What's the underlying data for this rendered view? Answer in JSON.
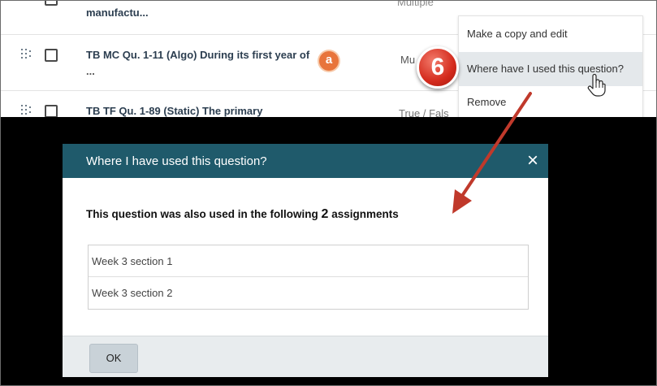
{
  "question_list": {
    "rows": [
      {
        "title": "manufactu...",
        "type": "Multiple"
      },
      {
        "title": "TB MC Qu. 1-11 (Algo) During its first year of",
        "title_cont": "...",
        "type": "Mu",
        "badge": "a"
      },
      {
        "title": "TB TF Qu. 1-89 (Static) The primary",
        "type": "True / Fals"
      }
    ]
  },
  "context_menu": {
    "items": [
      {
        "label": "Make a copy and edit"
      },
      {
        "label": "Where have I used this question?",
        "highlighted": true
      },
      {
        "label": "Remove"
      }
    ]
  },
  "step_marker": {
    "number": "6",
    "color": "#d42b1d"
  },
  "modal": {
    "title": "Where I have used this question?",
    "close_icon": "×",
    "message_prefix": "This question was also used in the following",
    "count": "2",
    "message_suffix": "assignments",
    "assignments": [
      {
        "name": "Week 3 section 1"
      },
      {
        "name": "Week 3 section 2"
      }
    ],
    "ok_label": "OK",
    "header_color": "#1f5a6b"
  },
  "annotation_arrow_color": "#c0392b"
}
